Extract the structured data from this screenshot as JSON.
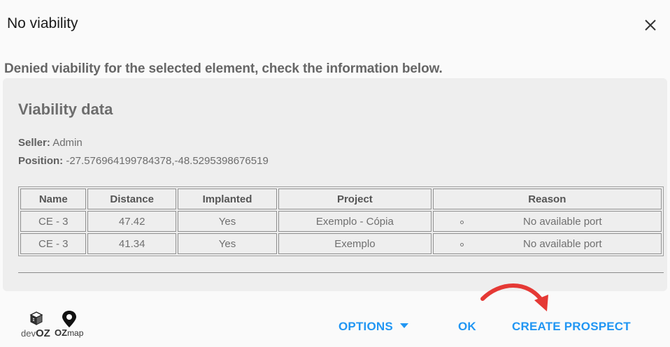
{
  "dialog": {
    "title": "No viability",
    "subtitle": "Denied viability for the selected element, check the information below."
  },
  "card": {
    "title": "Viability data",
    "seller_label": "Seller:",
    "seller_value": "Admin",
    "position_label": "Position:",
    "position_value": "-27.576964199784378,-48.5295398676519"
  },
  "table": {
    "headers": [
      "Name",
      "Distance",
      "Implanted",
      "Project",
      "Reason"
    ],
    "rows": [
      [
        "CE - 3",
        "47.42",
        "Yes",
        "Exemplo - Cópia",
        "No available port"
      ],
      [
        "CE - 3",
        "41.34",
        "Yes",
        "Exemplo",
        "No available port"
      ]
    ]
  },
  "footer": {
    "logo_devoz_text_1": "dev",
    "logo_devoz_text_2": "OZ",
    "logo_ozmap_text_1": "OZ",
    "logo_ozmap_text_2": "map",
    "options_label": "OPTIONS",
    "ok_label": "OK",
    "create_prospect_label": "CREATE PROSPECT"
  },
  "colors": {
    "accent": "#2196f3",
    "annotation_arrow": "#e53935"
  },
  "icons": {
    "close": "close-icon",
    "options_caret": "caret-down-icon",
    "devoz_logo": "box-logo",
    "ozmap_logo": "map-pin-logo",
    "annotation": "curved-arrow-annotation"
  }
}
